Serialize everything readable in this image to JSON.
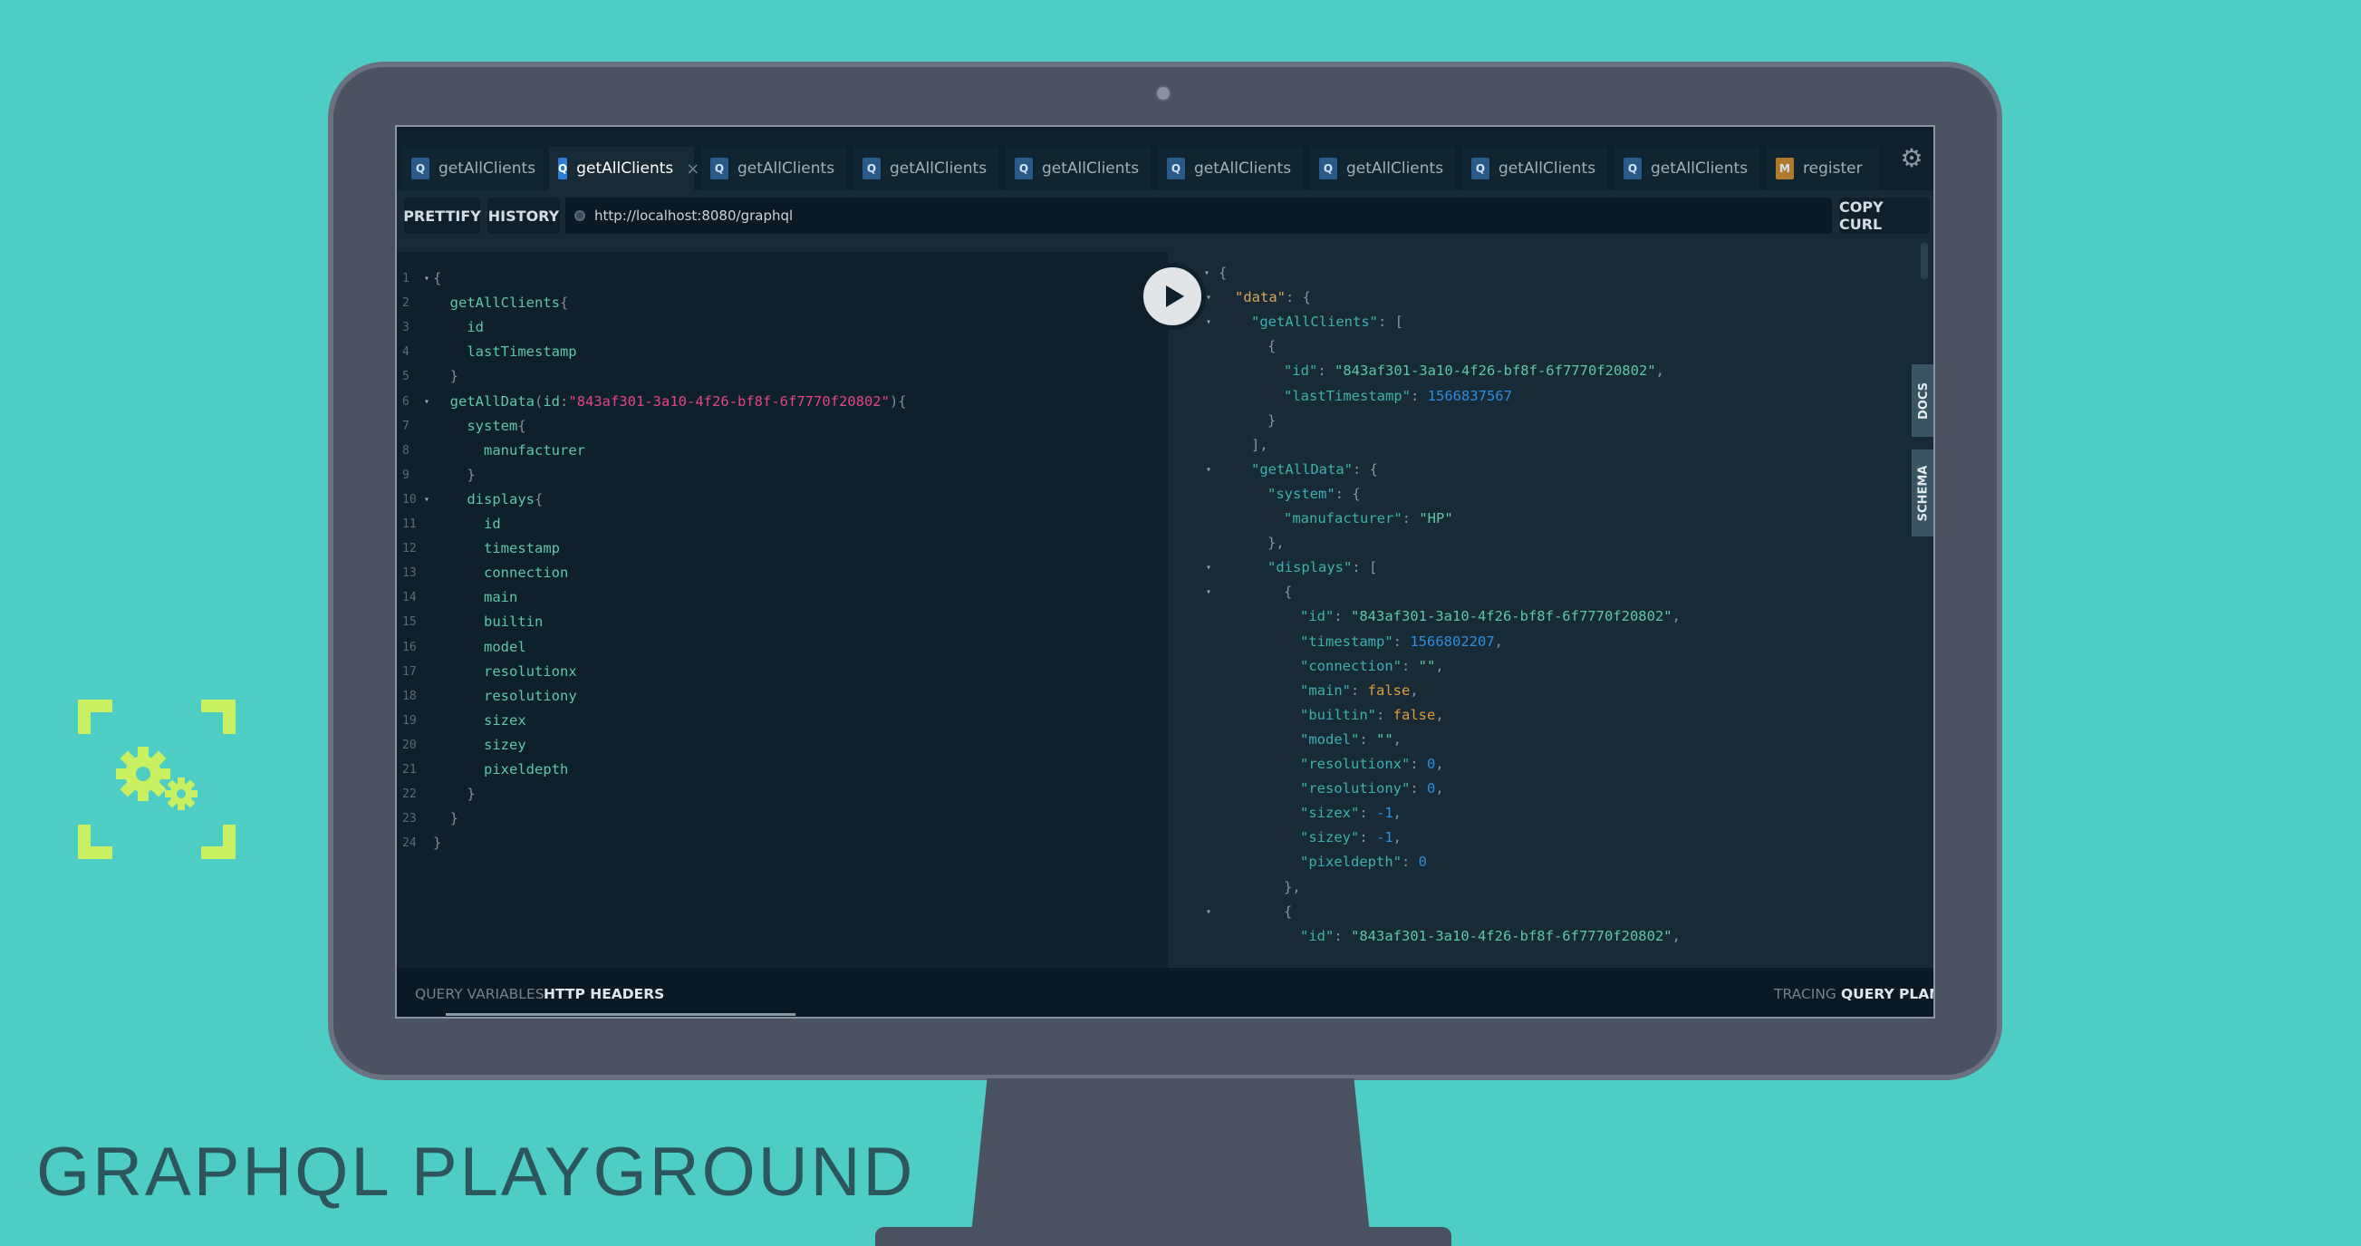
{
  "page_title": "GRAPHQL PLAYGROUND",
  "colors": {
    "background": "#4ecdc4",
    "accent": "#c8f060",
    "monitor": "#4b5260"
  },
  "tabs": [
    {
      "icon": "Q",
      "label": "getAllClients",
      "active": false
    },
    {
      "icon": "Q",
      "label": "getAllClients",
      "active": true,
      "close": "×"
    },
    {
      "icon": "Q",
      "label": "getAllClients",
      "active": false
    },
    {
      "icon": "Q",
      "label": "getAllClients",
      "active": false
    },
    {
      "icon": "Q",
      "label": "getAllClients",
      "active": false
    },
    {
      "icon": "Q",
      "label": "getAllClients",
      "active": false
    },
    {
      "icon": "Q",
      "label": "getAllClients",
      "active": false
    },
    {
      "icon": "Q",
      "label": "getAllClients",
      "active": false
    },
    {
      "icon": "Q",
      "label": "getAllClients",
      "active": false
    },
    {
      "icon": "M",
      "label": "register",
      "active": false
    }
  ],
  "settings_icon": "gear-icon",
  "toolbar": {
    "prettify": "PRETTIFY",
    "history": "HISTORY",
    "url": "http://localhost:8080/graphql",
    "copy_curl": "COPY CURL"
  },
  "side_tabs": {
    "docs": "DOCS",
    "schema": "SCHEMA"
  },
  "editor": {
    "line_numbers": [
      "1",
      "2",
      "3",
      "4",
      "5",
      "6",
      "7",
      "8",
      "9",
      "10",
      "11",
      "12",
      "13",
      "14",
      "15",
      "16",
      "17",
      "18",
      "19",
      "20",
      "21",
      "22",
      "23",
      "24"
    ],
    "lines": [
      [
        "{"
      ],
      [
        "  ",
        "getAllClients",
        "{"
      ],
      [
        "    ",
        "id"
      ],
      [
        "    ",
        "lastTimestamp"
      ],
      [
        "  ",
        "}"
      ],
      [
        "  ",
        "getAllData",
        "(",
        "id",
        ":",
        "\"843af301-3a10-4f26-bf8f-6f7770f20802\"",
        "){"
      ],
      [
        "    ",
        "system",
        "{"
      ],
      [
        "      ",
        "manufacturer"
      ],
      [
        "    ",
        "}"
      ],
      [
        "    ",
        "displays",
        "{"
      ],
      [
        "      ",
        "id"
      ],
      [
        "      ",
        "timestamp"
      ],
      [
        "      ",
        "connection"
      ],
      [
        "      ",
        "main"
      ],
      [
        "      ",
        "builtin"
      ],
      [
        "      ",
        "model"
      ],
      [
        "      ",
        "resolutionx"
      ],
      [
        "      ",
        "resolutiony"
      ],
      [
        "      ",
        "sizex"
      ],
      [
        "      ",
        "sizey"
      ],
      [
        "      ",
        "pixeldepth"
      ],
      [
        "    ",
        "}"
      ],
      [
        "  ",
        "}"
      ],
      [
        "}"
      ]
    ]
  },
  "result": {
    "lines": [
      "{",
      "\"data\": {",
      "\"getAllClients\": [",
      "{",
      "\"id\": \"843af301-3a10-4f26-bf8f-6f7770f20802\",",
      "\"lastTimestamp\": 1566837567",
      "}",
      "],",
      "\"getAllData\": {",
      "\"system\": {",
      "\"manufacturer\": \"HP\"",
      "},",
      "\"displays\": [",
      "{",
      "\"id\": \"843af301-3a10-4f26-bf8f-6f7770f20802\",",
      "\"timestamp\": 1566802207,",
      "\"connection\": \"\",",
      "\"main\": false,",
      "\"builtin\": false,",
      "\"model\": \"\",",
      "\"resolutionx\": 0,",
      "\"resolutiony\": 0,",
      "\"sizex\": -1,",
      "\"sizey\": -1,",
      "\"pixeldepth\": 0",
      "},",
      "{",
      "\"id\": \"843af301-3a10-4f26-bf8f-6f7770f20802\","
    ]
  },
  "bottom": {
    "query_variables": "QUERY VARIABLES",
    "http_headers": "HTTP HEADERS",
    "tracing": "TRACING",
    "query_plan": "QUERY PLAN"
  }
}
